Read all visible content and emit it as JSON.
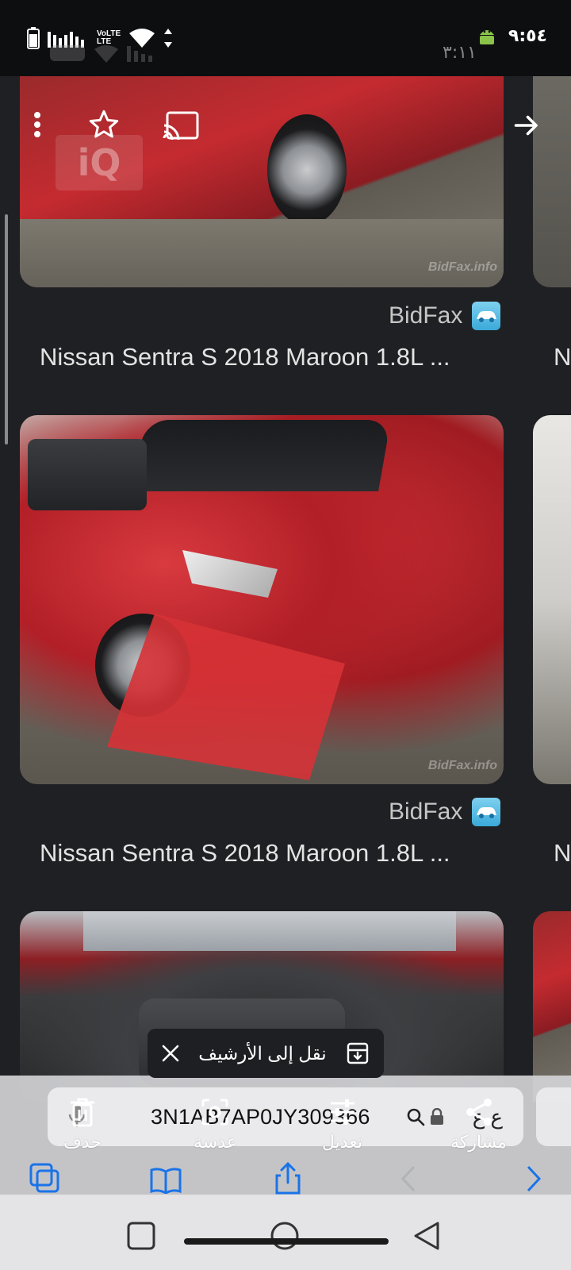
{
  "status_bar": {
    "time": "٩:٥٤",
    "secondary_time": "٣:١١",
    "network_label_top": "VoLTE",
    "network_label_bottom": "LTE"
  },
  "results": [
    {
      "source": "BidFax",
      "title": "Nissan Sentra S 2018 Maroon 1.8L ...",
      "watermark": "BidFax.info"
    },
    {
      "source": "BidFax",
      "title": "Nissan Sentra S 2018 Maroon 1.8L ...",
      "watermark": "BidFax.info"
    }
  ],
  "side_titles": [
    "N",
    "N"
  ],
  "overlay_watermark": "iQ",
  "toast": {
    "text": "نقل إلى الأرشيف"
  },
  "url_bar": {
    "url": "3N1AB7AP0JY309366",
    "lang": "ع ع"
  },
  "toolbar": {
    "delete_label": "حذف",
    "lens_label": "عدسة",
    "edit_label": "تعديل",
    "share_label": "مشاركة"
  },
  "colors": {
    "background": "#1f2023",
    "accent": "#1a73e8",
    "text": "#e3e3e3"
  }
}
